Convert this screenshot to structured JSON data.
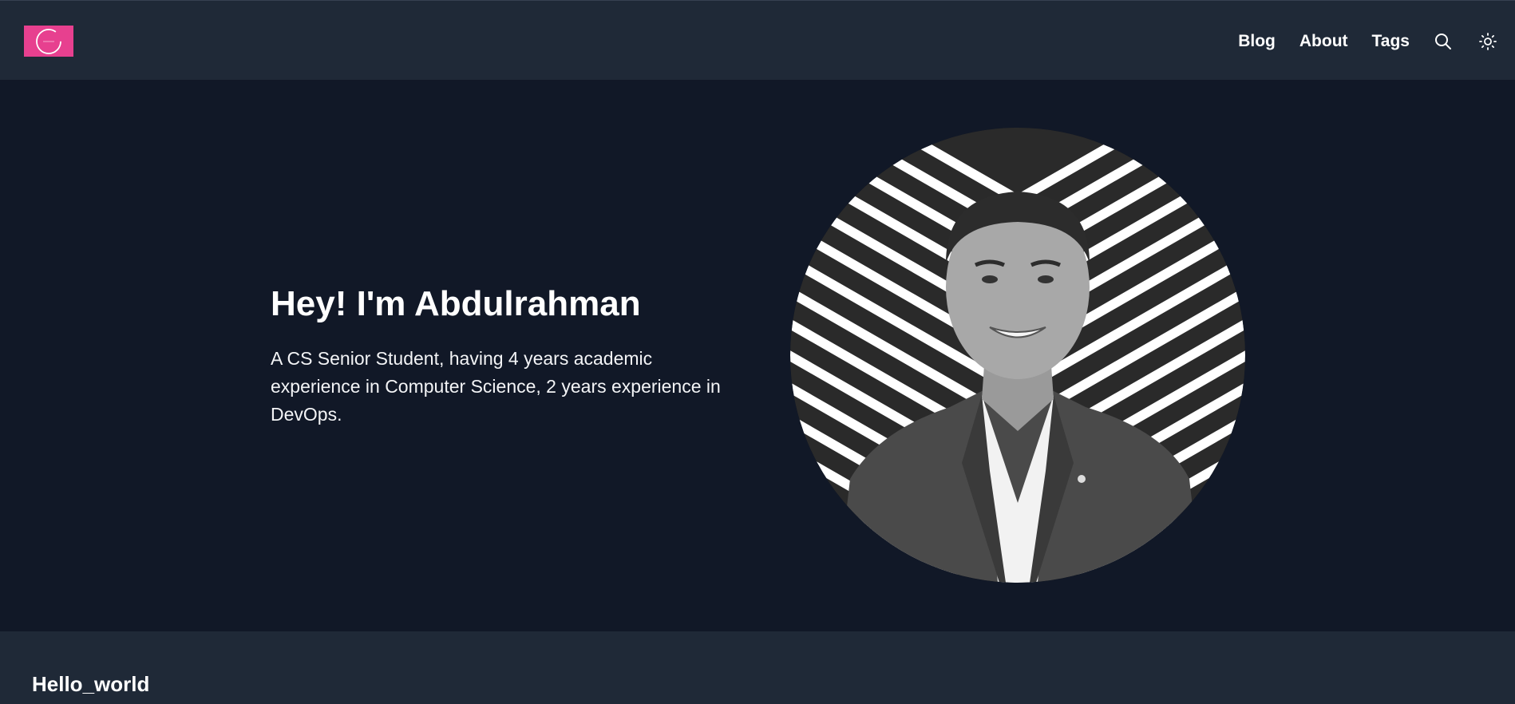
{
  "header": {
    "logo_icon": "brand-logo",
    "logo_color": "#e7408f",
    "nav": [
      {
        "label": "Blog"
      },
      {
        "label": "About"
      },
      {
        "label": "Tags"
      }
    ],
    "search_icon": "search-icon",
    "theme_icon": "sun-icon"
  },
  "hero": {
    "title": "Hey! I'm Abdulrahman",
    "description": "A CS Senior Student, having 4 years academic experience in Computer Science, 2 years experience in DevOps.",
    "avatar_icon": "profile-photo"
  },
  "posts": {
    "first_title": "Hello_world"
  },
  "colors": {
    "background": "#111827",
    "surface": "#1f2937",
    "text": "#ffffff",
    "accent": "#e7408f"
  }
}
